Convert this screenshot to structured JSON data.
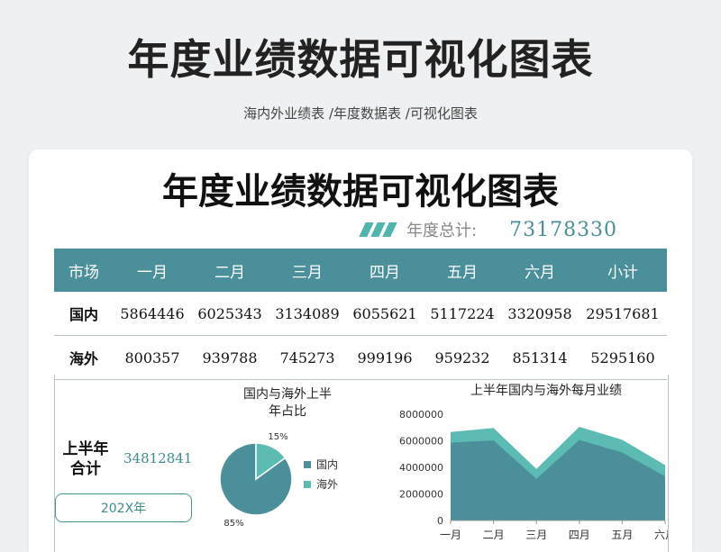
{
  "header": {
    "title": "年度业绩数据可视化图表",
    "subtitle": "海内外业绩表  /年度数据表  /可视化图表"
  },
  "card": {
    "title": "年度业绩数据可视化图表",
    "total_label": "年度总计:",
    "total_value": "73178330"
  },
  "table": {
    "columns": [
      "市场",
      "一月",
      "二月",
      "三月",
      "四月",
      "五月",
      "六月",
      "小计"
    ],
    "rows": [
      {
        "label": "国内",
        "cells": [
          "5864446",
          "6025343",
          "3134089",
          "6055621",
          "5117224",
          "3320958",
          "29517681"
        ]
      },
      {
        "label": "海外",
        "cells": [
          "800357",
          "939788",
          "745273",
          "999196",
          "959232",
          "851314",
          "5295160"
        ]
      }
    ]
  },
  "summary": {
    "half_label": "上半年合计",
    "half_value": "34812841",
    "year_button": "202X年"
  },
  "colors": {
    "domestic": "#4a8f9a",
    "overseas": "#5cbcb4",
    "header_bg": "#4a8f9a",
    "accent_text": "#3d8a8f"
  },
  "chart_data": [
    {
      "type": "pie",
      "title": "国内与海外上半年占比",
      "labels": [
        "国内",
        "海外"
      ],
      "values": [
        85,
        15
      ],
      "value_labels": [
        "85%",
        "15%"
      ],
      "legend": "right"
    },
    {
      "type": "area",
      "title": "上半年国内与海外每月业绩",
      "categories": [
        "一月",
        "二月",
        "三月",
        "四月",
        "五月",
        "六月"
      ],
      "series": [
        {
          "values": [
            5864446,
            6025343,
            3134089,
            6055621,
            5117224,
            3320958
          ]
        },
        {
          "values": [
            800357,
            939788,
            745273,
            999196,
            959232,
            851314
          ]
        }
      ],
      "stacked": true,
      "ylim": [
        0,
        8000000
      ],
      "yticks": [
        "8000000",
        "6000000",
        "4000000",
        "2000000",
        "0"
      ],
      "grid": false
    }
  ]
}
